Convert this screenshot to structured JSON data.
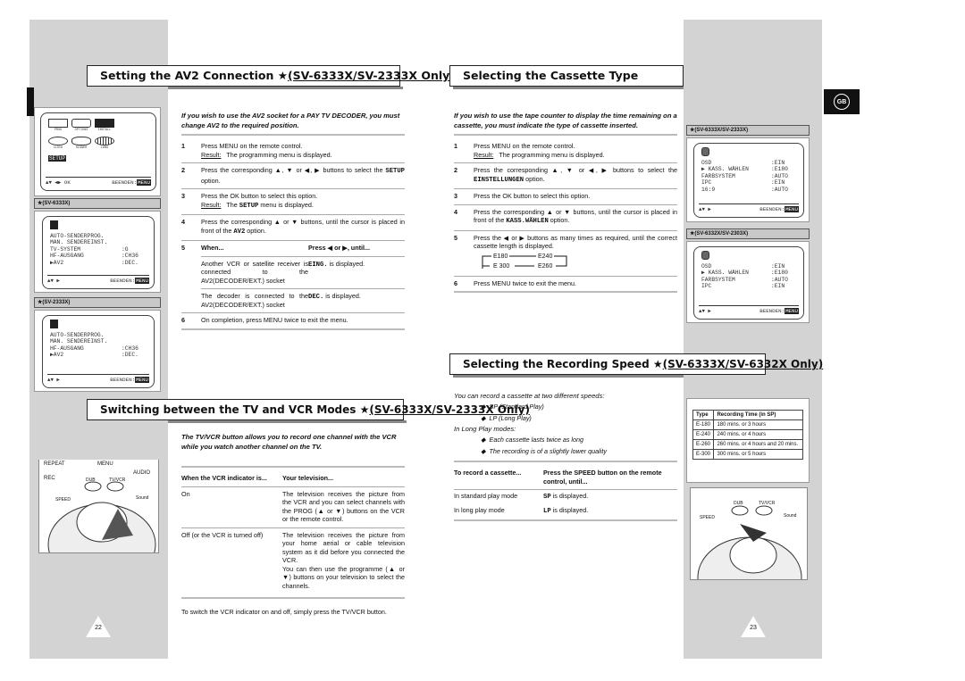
{
  "left": {
    "av2": {
      "title_main": "Setting the AV2 Connection ",
      "title_star": "★",
      "title_sub": "(SV-6333X/SV-2333X Only)",
      "intro": "If you wish to use the AV2 socket for a PAY TV DECODER, you must change AV2 to the required position.",
      "steps": [
        {
          "n": "1",
          "text": "Press MENU on the remote control.",
          "result_label": "Result:",
          "result": "The programming menu is displayed."
        },
        {
          "n": "2",
          "text": "Press the corresponding ▲, ▼ or ◀, ▶ buttons to select the",
          "code": "SETUP",
          "after": " option."
        },
        {
          "n": "3",
          "text": "Press the OK button to select this option.",
          "result_label": "Result:",
          "result_pre": "The ",
          "code": "SETUP",
          "result_post": " menu is displayed."
        },
        {
          "n": "4",
          "text": "Press the corresponding ▲ or ▼ buttons, until the cursor is placed in front of the ",
          "code": "AV2",
          "after": " option."
        },
        {
          "n": "5",
          "when": "When...",
          "press": "Press ◀ or ▶, until...",
          "rows": [
            {
              "when": "Another VCR or satellite receiver is connected to the AV2(DECODER/EXT.) socket",
              "code": "EING.",
              "press": " is displayed."
            },
            {
              "when": "The decoder is connected to the AV2(DECODER/EXT.) socket",
              "code": "DEC.",
              "press": " is displayed."
            }
          ]
        },
        {
          "n": "6",
          "text": "On completion, press MENU twice to exit the menu."
        }
      ]
    },
    "screens": {
      "main": {
        "icons": [
          "PROG",
          "OPTIONS",
          "INSTALL",
          "CLOCK",
          "SIGNER",
          "LANG"
        ],
        "selected": "SETUP",
        "foot_keys": "▲▼ ◀▶ OK",
        "foot": "BEENDEN:",
        "menu": "MENU"
      },
      "h1": "(SV-6333X)",
      "h2": "(SV-2333X)",
      "install": "INSTALL",
      "s1": [
        [
          "AUTO-SENDERPROG.",
          ""
        ],
        [
          "MAN. SENDEREINST.",
          ""
        ],
        [
          "TV-SYSTEM",
          ":G"
        ],
        [
          "HF-AUSGANG",
          ":CH36"
        ],
        [
          "▶AV2",
          ":DEC."
        ]
      ],
      "s2": [
        [
          "AUTO-SENDERPROG.",
          ""
        ],
        [
          "MAN. SENDEREINST.",
          ""
        ],
        [
          "HF-AUSGANG",
          ":CH36"
        ],
        [
          "▶AV2",
          ":DEC."
        ]
      ],
      "foot_keys": "▲▼   ▶"
    },
    "tvvcr": {
      "title_main": "Switching between the TV and VCR Modes ",
      "title_star": "★",
      "title_sub": "(SV-6333X/SV-2333X Only)",
      "intro": "The TV/VCR button allows you to record one channel with the VCR while you watch another channel on the TV.",
      "col1": "When the VCR indicator is...",
      "col2": "Your television...",
      "rows": [
        {
          "a": "On",
          "b": "The television receives the picture from the VCR and you can select channels with the PROG (▲ or ▼) buttons on the VCR or the remote control."
        },
        {
          "a": "Off (or the VCR is turned off)",
          "b": "The television receives the picture from your home aerial or cable television system as it did before you connected the VCR.",
          "b2": "You can then use the programme (▲ or ▼) buttons on your television to select the channels."
        }
      ],
      "footer": "To switch the VCR indicator on and off, simply press the TV/VCR button."
    },
    "remote_labels": [
      "REPEAT",
      "MENU",
      "AUDIO",
      "REC",
      "DUB",
      "TV/VCR",
      "SPEED",
      "Sound"
    ],
    "page": "22"
  },
  "right": {
    "cassette": {
      "title": "Selecting the Cassette Type",
      "intro": "If you wish to use the tape counter to display the time remaining on a cassette, you must indicate the type of cassette inserted.",
      "steps": [
        {
          "n": "1",
          "text": "Press MENU on the remote control.",
          "result_label": "Result:",
          "result": "The programming menu is displayed."
        },
        {
          "n": "2",
          "text": "Press the corresponding ▲, ▼ or ◀, ▶ buttons to select the ",
          "code": "EINSTELLUNGEN",
          "after": " option."
        },
        {
          "n": "3",
          "text": "Press the OK button to select this option."
        },
        {
          "n": "4",
          "text": "Press the corresponding ▲ or ▼ buttons, until the cursor is placed in front of the ",
          "code": "KASS.WÄHLEN",
          "after": " option."
        },
        {
          "n": "5",
          "text": "Press the ◀ or ▶ buttons as many times as required, until the correct cassette length is displayed."
        },
        {
          "n": "6",
          "text": "Press MENU twice to exit the menu."
        }
      ],
      "cycle": [
        "E180",
        "E240",
        "E260",
        "E 300"
      ]
    },
    "screens": {
      "h1": "(SV-6333X/SV-2333X)",
      "h2": "(SV-6332X/SV-2303X)",
      "options": "OPTIONS",
      "s1": [
        [
          "OSD",
          ":EIN"
        ],
        [
          "▶ KASS. WÄHLEN",
          ":E180"
        ],
        [
          "FARBSYSTEM",
          ":AUTO"
        ],
        [
          "IPC",
          ":EIN"
        ],
        [
          "16:9",
          ":AUTO"
        ]
      ],
      "s2": [
        [
          "OSD",
          ":EIN"
        ],
        [
          "▶ KASS. WÄHLEN",
          ":E180"
        ],
        [
          "FARBSYSTEM",
          ":AUTO"
        ],
        [
          "IPC",
          ":EIN"
        ]
      ],
      "foot_keys": "▲▼    ▶",
      "foot": "BEENDEN:",
      "menu": "MENU"
    },
    "speed": {
      "title_main": "Selecting the Recording Speed ",
      "title_star": "★",
      "title_sub": "(SV-6333X/SV-6332X Only)",
      "intro": "You can record a cassette at two different speeds:",
      "speeds": [
        "SP (Standard Play)",
        "LP (Long Play)"
      ],
      "lp_head": "In Long Play modes:",
      "lp_points": [
        "Each cassette lasts twice as long",
        "The recording is of a slightly lower quality"
      ],
      "col1": "To record a cassette...",
      "col2": "Press the SPEED button on the remote control, until...",
      "rows": [
        {
          "a": "In standard play mode",
          "code": "SP",
          "b": " is displayed."
        },
        {
          "a": "In long play mode",
          "code": "LP",
          "b": " is displayed."
        }
      ]
    },
    "table": {
      "headers": [
        "Type",
        "Recording Time (in SP)"
      ],
      "rows": [
        [
          "E-180",
          "180 mins. or 3 hours"
        ],
        [
          "E-240",
          "240 mins. or 4 hours"
        ],
        [
          "E-260",
          "260 mins. or 4 hours and 20 mins."
        ],
        [
          "E-300",
          "300 mins. or 5 hours"
        ]
      ]
    },
    "remote_labels": [
      "DUB",
      "TV/VCR",
      "SPEED",
      "Sound"
    ],
    "page": "23",
    "lang_badge": "GB"
  }
}
